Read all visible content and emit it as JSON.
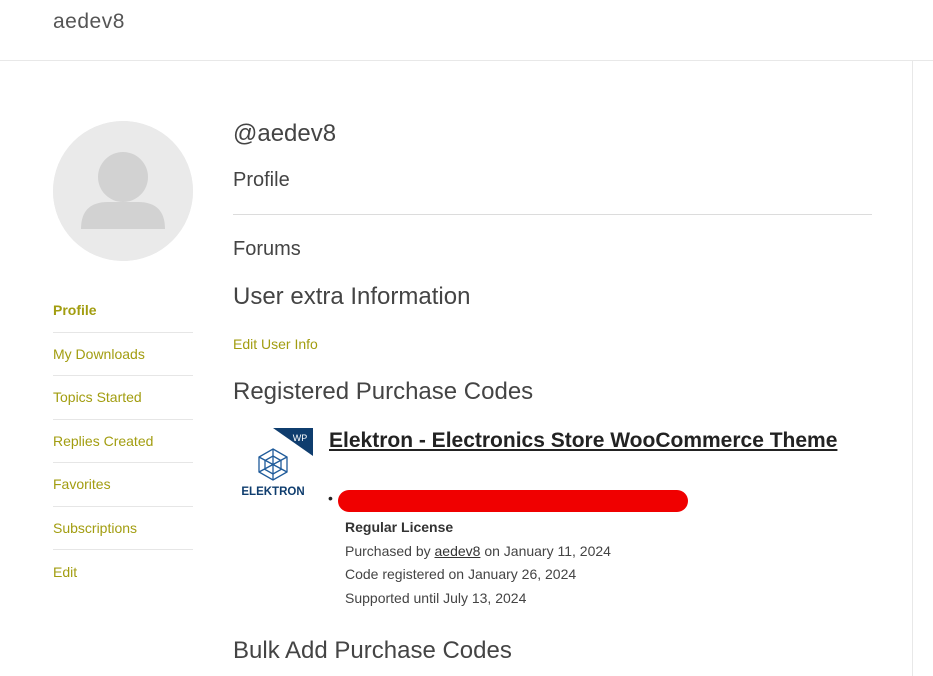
{
  "site": {
    "title": "aedev8"
  },
  "sidebar": {
    "items": [
      {
        "label": "Profile",
        "active": true
      },
      {
        "label": "My Downloads",
        "active": false
      },
      {
        "label": "Topics Started",
        "active": false
      },
      {
        "label": "Replies Created",
        "active": false
      },
      {
        "label": "Favorites",
        "active": false
      },
      {
        "label": "Subscriptions",
        "active": false
      },
      {
        "label": "Edit",
        "active": false
      }
    ]
  },
  "main": {
    "handle": "@aedev8",
    "profile_heading": "Profile",
    "forums_heading": "Forums",
    "extra_info_heading": "User extra Information",
    "edit_user_info_link": "Edit User Info",
    "purchase_codes_heading": "Registered Purchase Codes",
    "bulk_add_heading": "Bulk Add Purchase Codes"
  },
  "purchase": {
    "thumbnail_badge": "WP",
    "thumbnail_brand": "ELEKTRON",
    "product_title": "Elektron - Electronics Store WooCommerce Theme",
    "bullet": "•",
    "license_type": "Regular License",
    "purchased_by_prefix": "Purchased by",
    "purchased_by_user": "aedev8",
    "purchased_on": "on January 11, 2024",
    "code_registered": "Code registered on January 26, 2024",
    "supported_until": "Supported until July 13, 2024"
  },
  "colors": {
    "accent": "#a29d10",
    "redaction": "#f00000",
    "thumbnail_navy": "#0f3d6e"
  }
}
